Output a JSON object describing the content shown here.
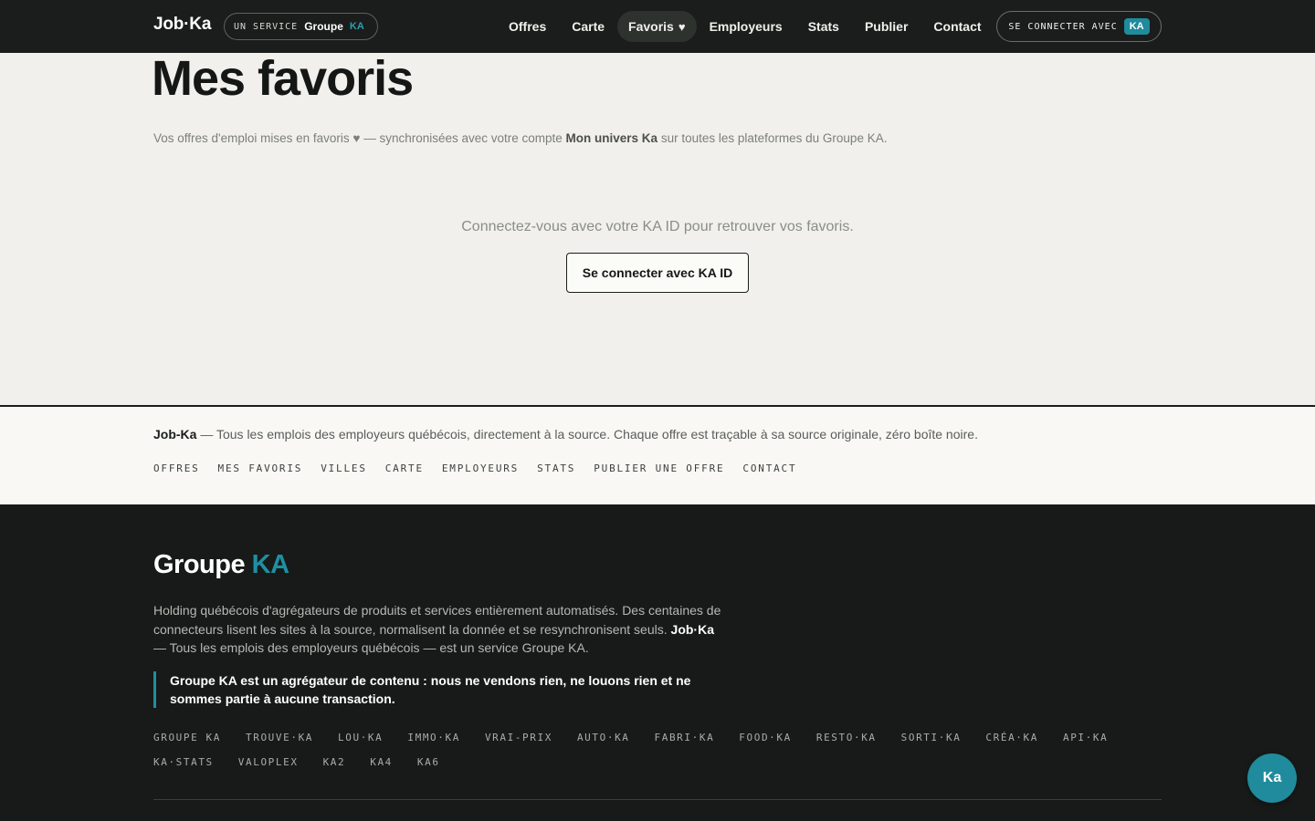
{
  "header": {
    "brand": "Job·Ka",
    "service_prefix": "UN SERVICE",
    "service_group": "Groupe",
    "service_ka": "KA",
    "nav": [
      {
        "label": "Offres"
      },
      {
        "label": "Carte"
      },
      {
        "label": "Favoris",
        "active": true
      },
      {
        "label": "Employeurs"
      },
      {
        "label": "Stats"
      },
      {
        "label": "Publier"
      },
      {
        "label": "Contact"
      }
    ],
    "login_label": "SE CONNECTER AVEC",
    "login_badge": "KA"
  },
  "main": {
    "title": "Mes favoris",
    "intro_before": "Vos offres d'emploi mises en favoris ♥ — synchronisées avec votre compte ",
    "intro_bold": "Mon univers Ka",
    "intro_after": " sur toutes les plateformes du Groupe KA.",
    "empty_message": "Connectez-vous avec votre KA ID pour retrouver vos favoris.",
    "connect_button": "Se connecter avec KA ID"
  },
  "footer_light": {
    "brand": "Job-Ka",
    "tagline": " — Tous les emplois des employeurs québécois, directement à la source. Chaque offre est traçable à sa source originale, zéro boîte noire.",
    "links": [
      "OFFRES",
      "MES FAVORIS",
      "VILLES",
      "CARTE",
      "EMPLOYEURS",
      "STATS",
      "PUBLIER UNE OFFRE",
      "CONTACT"
    ]
  },
  "footer_dark": {
    "title_main": "Groupe ",
    "title_ka": "KA",
    "desc_before": "Holding québécois d'agrégateurs de produits et services entièrement automatisés. Des centaines de connecteurs lisent les sites à la source, normalisent la donnée et se resynchronisent seuls. ",
    "desc_bold": "Job·Ka",
    "desc_after": " — Tous les emplois des employeurs québécois — est un service Groupe KA.",
    "disclaimer": "Groupe KA est un agrégateur de contenu : nous ne vendons rien, ne louons rien et ne sommes partie à aucune transaction.",
    "network": [
      "GROUPE KA",
      "TROUVE·KA",
      "LOU·KA",
      "IMMO·KA",
      "VRAI-PRIX",
      "AUTO·KA",
      "FABRI·KA",
      "FOOD·KA",
      "RESTO·KA",
      "SORTI·KA",
      "CRÉA·KA",
      "API·KA",
      "KA·STATS",
      "VALOPLEX",
      "KA2",
      "KA4",
      "KA6"
    ]
  },
  "fab_label": "Ka",
  "colors": {
    "accent": "#1f8b9c",
    "dark": "#1a1d1b",
    "background": "#f1f0ec"
  }
}
